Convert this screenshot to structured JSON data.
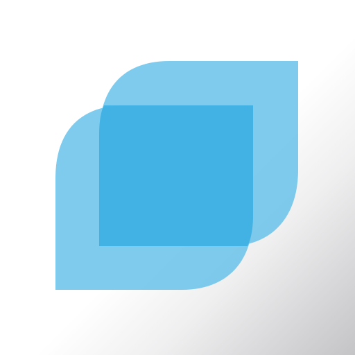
{
  "app": {
    "icon_name": "overlapping-leaves-logo-icon",
    "colors": {
      "background_light": "#ffffff",
      "background_shadow": "#c4c4c6",
      "leaf_light_blue": "#69c2ea",
      "leaf_dark_blue": "#3eb0e3"
    }
  }
}
